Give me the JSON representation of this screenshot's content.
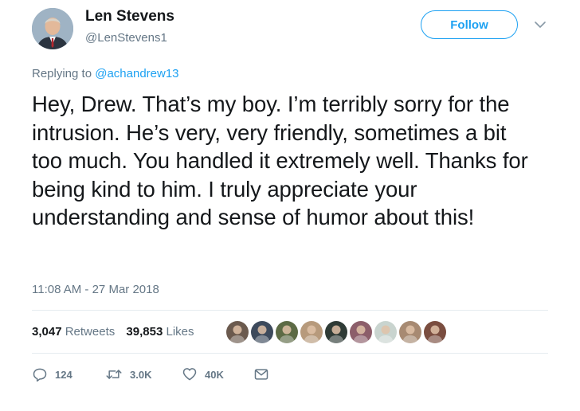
{
  "author": {
    "name": "Len Stevens",
    "handle": "@LenStevens1",
    "avatar_icon": "profile-photo"
  },
  "follow_label": "Follow",
  "reply": {
    "prefix": "Replying to",
    "mention": "@achandrew13"
  },
  "tweet_text": "Hey, Drew. That’s my boy. I’m terribly sorry for the intrusion. He’s very, very friendly, sometimes a bit too much. You handled it extremely well. Thanks for being kind to him. I truly appreciate your understanding and sense of humor about this!",
  "timestamp": "11:08 AM - 27 Mar 2018",
  "stats": {
    "retweets_count": "3,047",
    "retweets_label": "Retweets",
    "likes_count": "39,853",
    "likes_label": "Likes"
  },
  "likers": [
    {
      "icon": "liker-avatar-1",
      "color": "#6b5a4e"
    },
    {
      "icon": "liker-avatar-2",
      "color": "#3d4a5c"
    },
    {
      "icon": "liker-avatar-3",
      "color": "#5d6b45"
    },
    {
      "icon": "liker-avatar-4",
      "color": "#b79a7c"
    },
    {
      "icon": "liker-avatar-5",
      "color": "#2f3b36"
    },
    {
      "icon": "liker-avatar-6",
      "color": "#8c5e6a"
    },
    {
      "icon": "liker-avatar-7",
      "color": "#c9d4cf"
    },
    {
      "icon": "liker-avatar-8",
      "color": "#a78a72"
    },
    {
      "icon": "liker-avatar-9",
      "color": "#7a4d3f"
    }
  ],
  "actions": {
    "replies": "124",
    "retweets": "3.0K",
    "likes": "40K"
  },
  "colors": {
    "accent": "#1da1f2",
    "secondary_text": "#657786",
    "primary_text": "#14171a",
    "divider": "#e6ecf0"
  }
}
